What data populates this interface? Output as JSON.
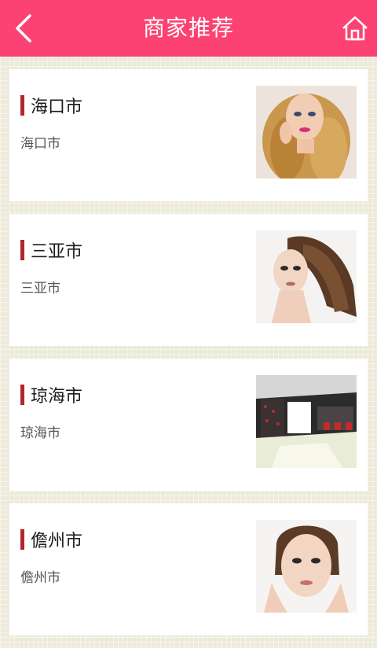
{
  "header": {
    "title": "商家推荐",
    "back_icon": "chevron-left-icon",
    "home_icon": "home-icon",
    "background": "#fb4272"
  },
  "merchants": [
    {
      "name": "海口市",
      "subtitle": "海口市",
      "image": "curly-blonde-woman-photo"
    },
    {
      "name": "三亚市",
      "subtitle": "三亚市",
      "image": "long-brown-hair-woman-photo"
    },
    {
      "name": "琼海市",
      "subtitle": "琼海市",
      "image": "salon-interior-photo"
    },
    {
      "name": "儋州市",
      "subtitle": "儋州市",
      "image": "woman-face-portrait-photo"
    }
  ],
  "accent": "#b3262b"
}
